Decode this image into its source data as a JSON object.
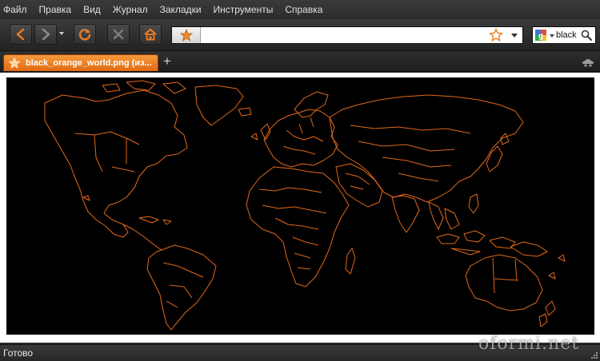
{
  "menubar": {
    "items": [
      "Файл",
      "Правка",
      "Вид",
      "Журнал",
      "Закладки",
      "Инструменты",
      "Справка"
    ]
  },
  "navbar": {
    "icons": [
      "back-arrow-icon",
      "forward-arrow-icon",
      "history-dropdown-icon",
      "reload-icon",
      "stop-icon",
      "home-icon"
    ],
    "url_value": "",
    "search_value": "black"
  },
  "tabs": [
    {
      "label": "black_orange_world.png (из...",
      "favicon": "star-icon",
      "active": true
    }
  ],
  "content": {
    "image_alt": "black_orange_world.png",
    "map_colors": {
      "background": "#000000",
      "outline": "#e2681a"
    }
  },
  "statusbar": {
    "text": "Готово"
  },
  "watermark": "oformi.net",
  "colors": {
    "accent": "#f08a30",
    "chrome_dark": "#2b2b2b",
    "tab_orange": "#e87a22"
  }
}
